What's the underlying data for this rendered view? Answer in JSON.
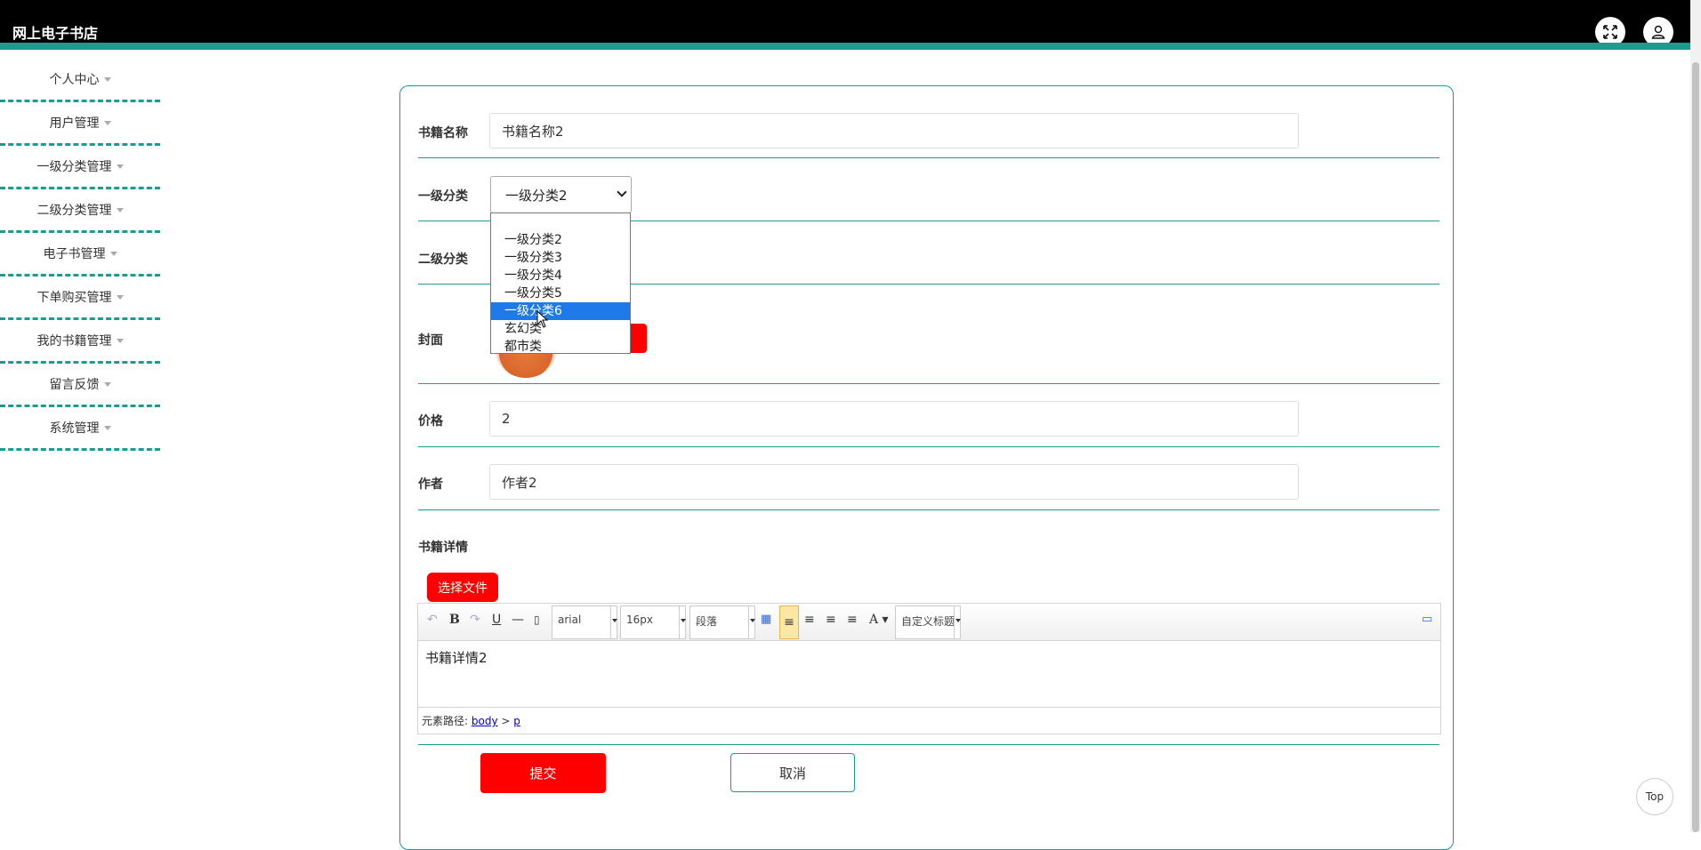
{
  "header": {
    "title": "网上电子书店"
  },
  "sidebar": {
    "items": [
      {
        "label": "个人中心"
      },
      {
        "label": "用户管理"
      },
      {
        "label": "一级分类管理"
      },
      {
        "label": "二级分类管理"
      },
      {
        "label": "电子书管理"
      },
      {
        "label": "下单购买管理"
      },
      {
        "label": "我的书籍管理"
      },
      {
        "label": "留言反馈"
      },
      {
        "label": "系统管理"
      }
    ]
  },
  "form": {
    "book_name_label": "书籍名称",
    "book_name_value": "书籍名称2",
    "category1_label": "一级分类",
    "category1_value": "一级分类2",
    "category1_options": [
      "",
      "一级分类2",
      "一级分类3",
      "一级分类4",
      "一级分类5",
      "一级分类6",
      "玄幻类",
      "都市类"
    ],
    "category1_highlighted": "一级分类6",
    "category2_label": "二级分类",
    "cover_label": "封面",
    "price_label": "价格",
    "price_value": "2",
    "author_label": "作者",
    "author_value": "作者2",
    "detail_label": "书籍详情",
    "choose_file_label": "选择文件"
  },
  "editor": {
    "font_family": "arial",
    "font_size": "16px",
    "paragraph": "段落",
    "custom_title": "自定义标题",
    "content": "书籍详情2",
    "path_label": "元素路径:",
    "path_body": "body",
    "path_sep": ">",
    "path_p": "p"
  },
  "actions": {
    "submit": "提交",
    "cancel": "取消"
  },
  "top_button": "Top",
  "colors": {
    "accent": "#1a9c8f",
    "primary": "#ff0000",
    "header_bg": "#000000"
  }
}
